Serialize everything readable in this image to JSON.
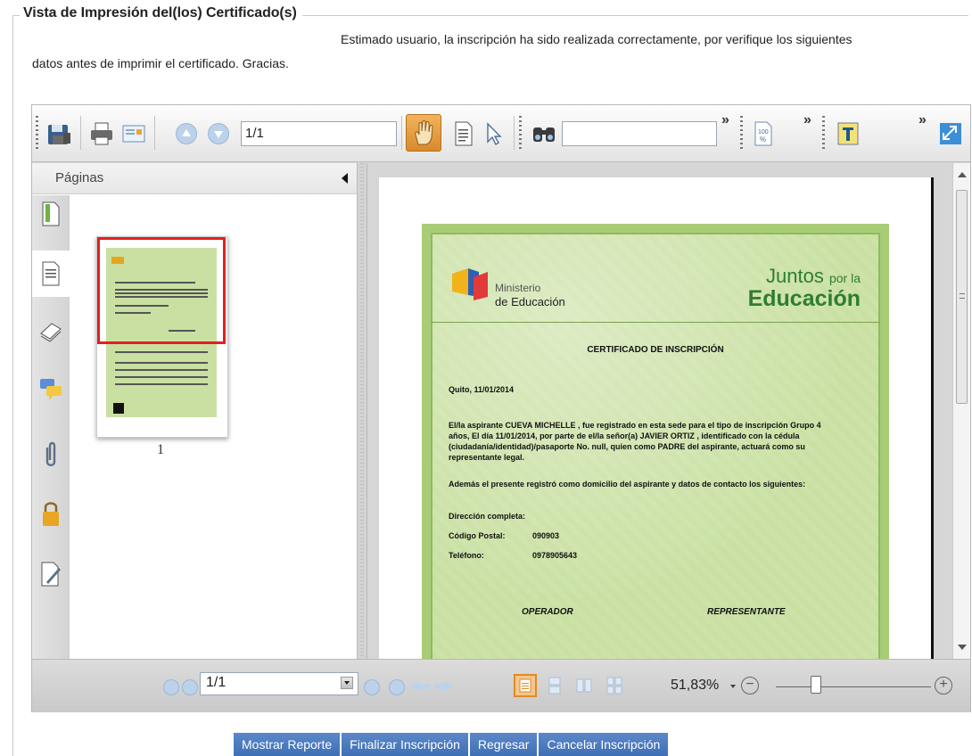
{
  "legend": "Vista de Impresión del(los) Certificado(s)",
  "message_line1": "Estimado usuario, la inscripción ha sido realizada correctamente, por verifique los siguientes",
  "message_line2": "datos antes de imprimir el certificado. Gracias.",
  "toolbar": {
    "page_field_value": "1/1",
    "search_value": "",
    "icons": [
      "save-icon",
      "print-icon",
      "properties-icon",
      "prev-page-icon",
      "next-page-icon",
      "hand-tool-icon",
      "text-select-icon",
      "pointer-icon",
      "find-icon",
      "zoom-percent-icon",
      "text-tool-icon",
      "fullscreen-icon"
    ]
  },
  "sidebar": {
    "title": "Páginas",
    "thumbnail_label": "1",
    "icons": [
      "bookmarks-icon",
      "pages-icon",
      "layers-icon",
      "comments-icon",
      "attachments-icon",
      "security-icon",
      "signatures-icon"
    ]
  },
  "document": {
    "ministry_line1": "Ministerio",
    "ministry_line2": "de Educación",
    "brand_line1": "Juntos",
    "brand_line1_small": "por la",
    "brand_line2": "Educación",
    "title": "CERTIFICADO DE INSCRIPCIÓN",
    "date_line": "Quito, 11/01/2014",
    "para1_l1": "El/la aspirante CUEVA  MICHELLE , fue registrado en esta sede para el tipo de inscripción Grupo 4",
    "para1_l2": "años, El día 11/01/2014, por parte de el/la señor(a) JAVIER ORTIZ , identificado con la cédula",
    "para1_l3": "(ciudadanía/identidad)/pasaporte No. null, quien como PADRE del aspirante, actuará como su",
    "para1_l4": "representante legal.",
    "para2": "Además el presente registró como domicilio del aspirante y datos de contacto los siguientes:",
    "address_label": "Dirección completa:",
    "postal_label": "Código Postal:",
    "postal_value": "090903",
    "phone_label": "Teléfono:",
    "phone_value": "0978905643",
    "sign_left": "OPERADOR",
    "sign_right": "REPRESENTANTE"
  },
  "bottombar": {
    "page_value": "1/1",
    "zoom_text": "51,83%",
    "zoom_level_percent": 51.83
  },
  "actions": {
    "show_report": "Mostrar Reporte",
    "finish": "Finalizar Inscripción",
    "back": "Regresar",
    "cancel": "Cancelar Inscripción"
  },
  "colors": {
    "action_button": "#4a7abf",
    "active_tool": "#e08a26",
    "certificate_bg": "#c9e0a2",
    "thumbnail_frame": "#e02020"
  }
}
